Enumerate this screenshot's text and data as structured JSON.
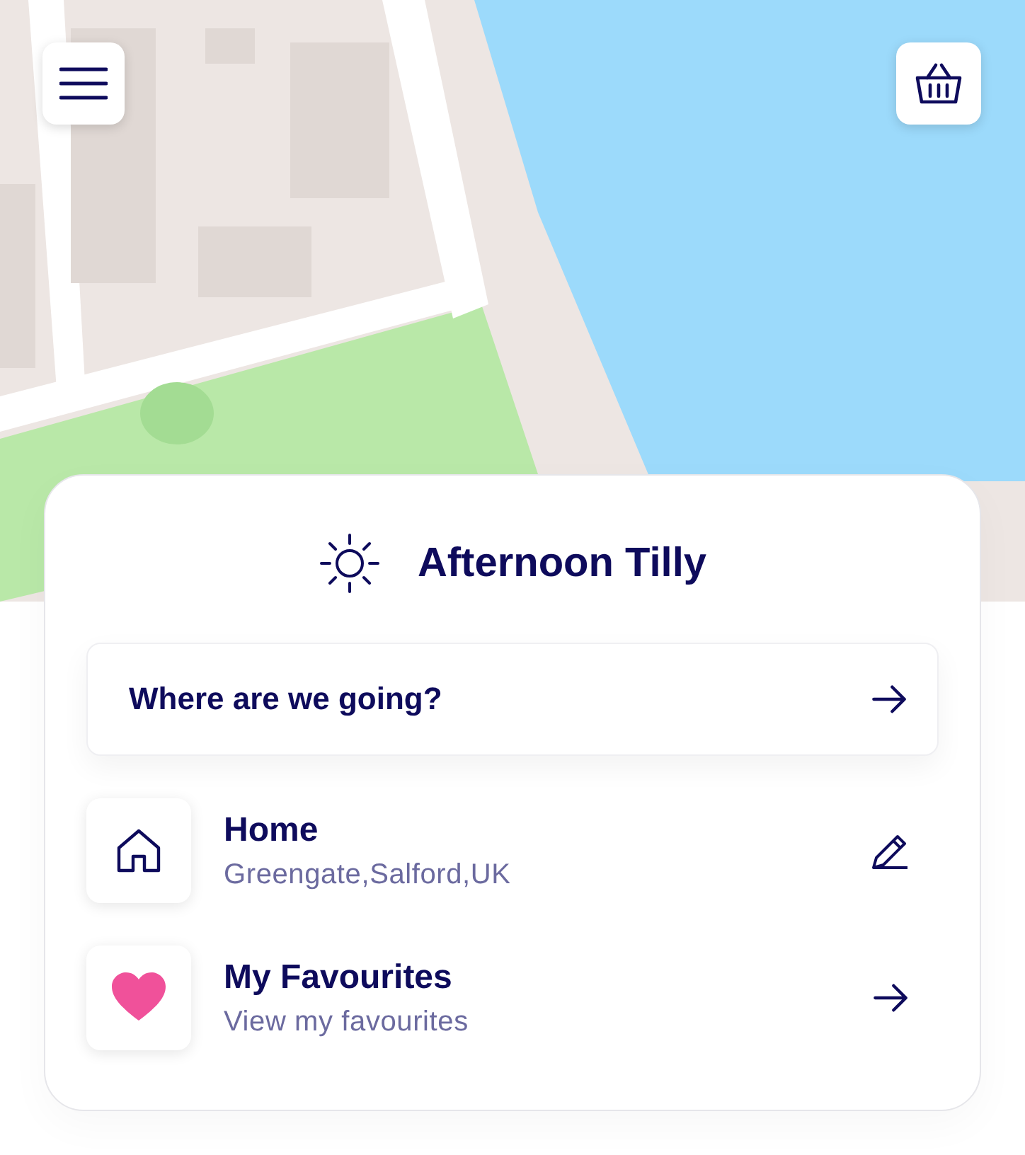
{
  "greeting": {
    "text": "Afternoon Tilly"
  },
  "search": {
    "label": "Where are we going?"
  },
  "places": [
    {
      "kind": "home",
      "title": "Home",
      "subtitle": "Greengate,Salford,UK"
    },
    {
      "kind": "favourites",
      "title": "My Favourites",
      "subtitle": "View my favourites"
    }
  ]
}
